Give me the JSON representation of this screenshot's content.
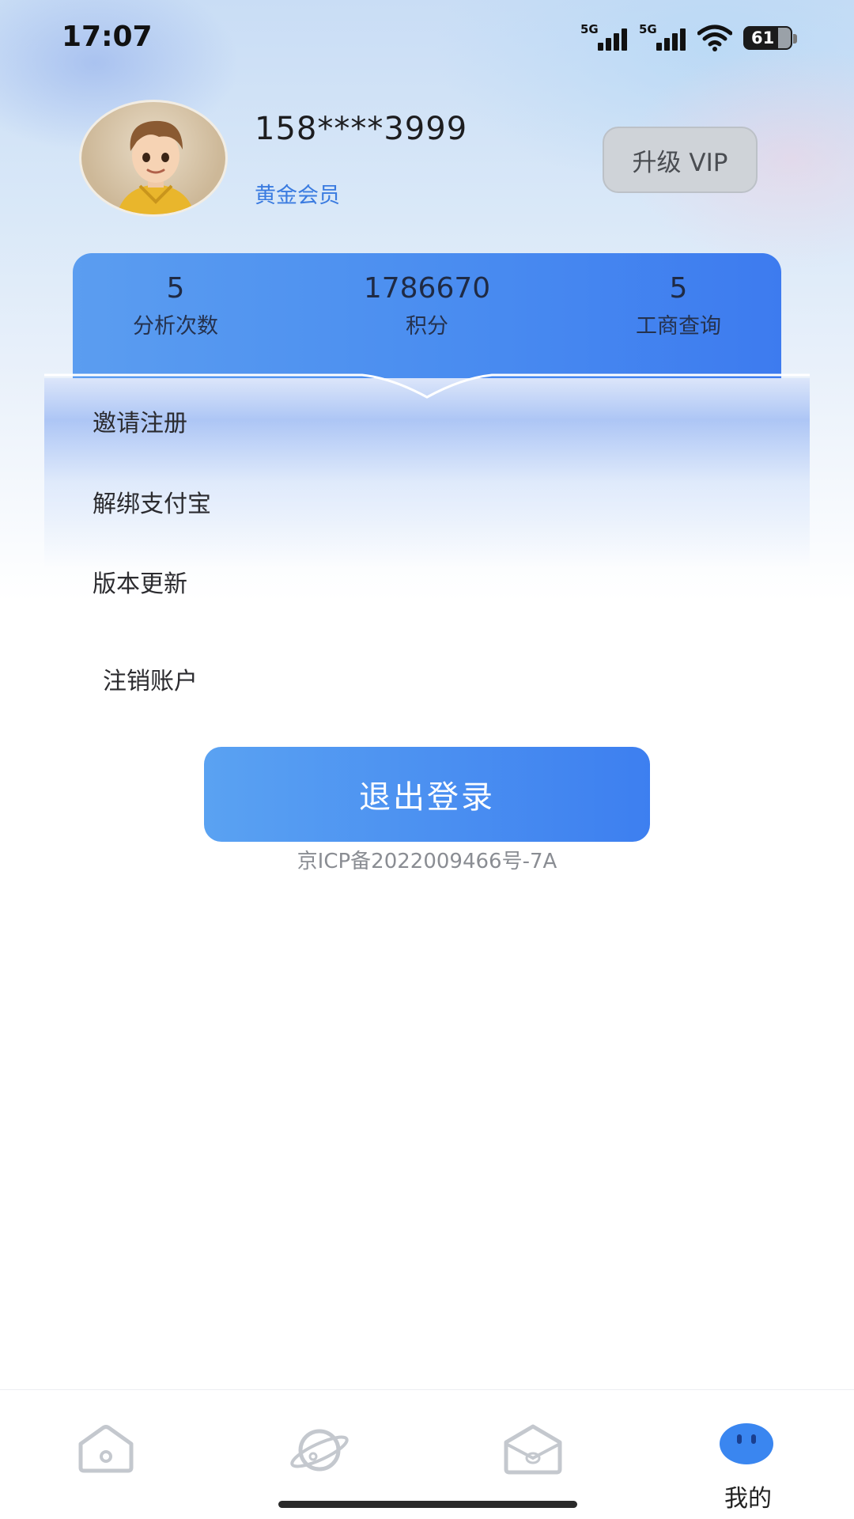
{
  "status_bar": {
    "time": "17:07",
    "signal1_label": "5G",
    "signal2_label": "5G",
    "battery": "61"
  },
  "profile": {
    "phone": "158****3999",
    "member_level": "黄金会员",
    "vip_button": "升级 VIP"
  },
  "stats": [
    {
      "value": "5",
      "label": "分析次数"
    },
    {
      "value": "1786670",
      "label": "积分"
    },
    {
      "value": "5",
      "label": "工商查询"
    }
  ],
  "menu": {
    "items": [
      "邀请注册",
      "解绑支付宝",
      "版本更新"
    ],
    "cancel_account": "注销账户"
  },
  "logout_button": "退出登录",
  "icp": "京ICP备2022009466号-7A",
  "tabbar": {
    "tabs": [
      {
        "icon": "home-icon"
      },
      {
        "icon": "planet-icon"
      },
      {
        "icon": "package-icon"
      },
      {
        "icon": "face-icon",
        "label": "我的",
        "active": true
      }
    ]
  },
  "colors": {
    "accent": "#3d7ff0",
    "member": "#3a7be0"
  }
}
